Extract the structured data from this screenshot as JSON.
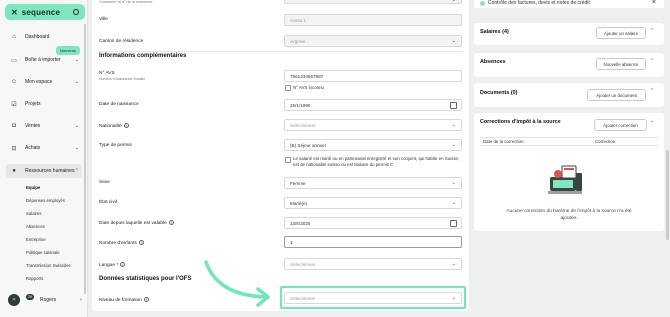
{
  "sidebar": {
    "brand": "sequence",
    "badge_new": "Nouveau",
    "items": [
      {
        "label": "Dashboard",
        "icon": "home-icon"
      },
      {
        "label": "Boîte à importer",
        "icon": "inbox-icon"
      },
      {
        "label": "Mon espace",
        "icon": "user-icon"
      },
      {
        "label": "Projets",
        "icon": "check-square-icon"
      },
      {
        "label": "Ventes",
        "icon": "bag-icon"
      },
      {
        "label": "Achats",
        "icon": "cart-icon"
      },
      {
        "label": "Ressources humaines",
        "icon": "people-icon"
      }
    ],
    "sub_items": [
      "Equipe",
      "Dépenses employés",
      "Salaires",
      "Absences",
      "Entreprise",
      "Politique salariale",
      "Transmission Swissdec",
      "Rapports"
    ],
    "user_name": "Rogers",
    "user_badge": "25"
  },
  "form": {
    "top_clip": "Commune et n° de la commune",
    "ville_label": "Ville",
    "ville_value": "Aarau 1",
    "canton_label": "Canton de résidence",
    "canton_value": "Argovie",
    "section_info": "Informations complémentaires",
    "avs_label": "N° AVS",
    "avs_sub": "Numéro d'Assurance Sociale",
    "avs_value": "7561234567897",
    "avs_unknown": "N° AVS inconnu",
    "dob_label": "Date de naissance",
    "dob_value": "25/1/1990",
    "nationality_label": "Nationalité",
    "nationality_value": "Sélectionner",
    "permit_label": "Type de permis",
    "permit_value": "(B) Séjour annuel",
    "married_text": "Le salarié est marié ou en partenariat enregistré et son conjoint, qui habite en Suisse, est de nationalité suisse ou est titulaire du permis C",
    "sexe_label": "Sexe",
    "sexe_value": "Femme",
    "civil_label": "État civil",
    "civil_value": "Marié(e)",
    "valid_label": "Date depuis laquelle est valable",
    "valid_value": "13/6/2025",
    "children_label": "Nombre d'enfants",
    "children_value": "1",
    "lang_label": "Langue *",
    "lang_value": "Sélectionner",
    "section_ofs": "Données statistiques pour l'OFS",
    "education_label": "Niveau de formation",
    "education_value": "Sélectionner"
  },
  "right": {
    "top_task": "Contrôle des factures, devis et notes de crédit",
    "salaires_title": "Salaires (4)",
    "salaires_btn": "Ajouter un salaire",
    "absences_title": "Absences",
    "absences_btn": "Nouvelle absence",
    "documents_title": "Documents (0)",
    "documents_btn": "Ajouter un document",
    "corrections_title": "Corrections d'impôt à la source",
    "corrections_btn": "Ajouter correction",
    "col_date": "Date de la correction",
    "col_correction": "Correction",
    "empty_msg": "Aucune correction du barème de l'impôt à la source n'a été ajoutée."
  },
  "colors": {
    "accent": "#7fe7bf",
    "highlight": "#6ee8b6"
  }
}
